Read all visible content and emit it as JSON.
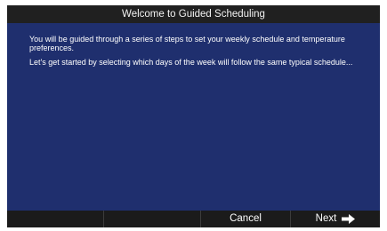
{
  "header": {
    "title": "Welcome to Guided Scheduling"
  },
  "content": {
    "paragraph_1": "You will be guided through a series of steps to set your weekly schedule and temperature preferences.",
    "paragraph_2": "Let's get started by selecting which days of the week will follow the same typical schedule..."
  },
  "footer": {
    "cancel_label": "Cancel",
    "next_label": "Next",
    "next_icon": "right-arrow-icon"
  },
  "colors": {
    "background": "#1f2f6e",
    "title_bar": "#202020",
    "bottom_bar": "#1b1b1b",
    "text": "#ffffff"
  }
}
